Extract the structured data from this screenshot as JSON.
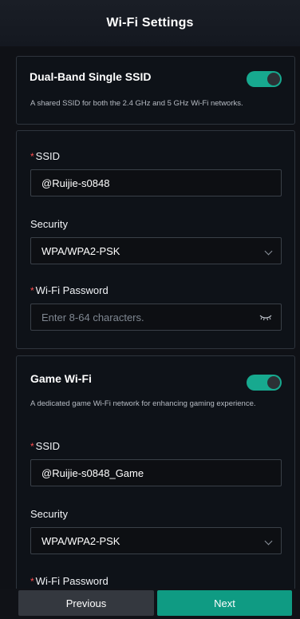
{
  "header": {
    "title": "Wi-Fi Settings"
  },
  "dual_band": {
    "title": "Dual-Band Single SSID",
    "description": "A shared SSID for both the 2.4 GHz and 5 GHz Wi-Fi networks.",
    "enabled": true
  },
  "main_wifi": {
    "ssid_label": "SSID",
    "ssid_value": "@Ruijie-s0848",
    "security_label": "Security",
    "security_value": "WPA/WPA2-PSK",
    "password_label": "Wi-Fi Password",
    "password_placeholder": "Enter 8-64 characters."
  },
  "game_wifi": {
    "title": "Game Wi-Fi",
    "description": "A dedicated game Wi-Fi network for enhancing gaming experience.",
    "enabled": true,
    "ssid_label": "SSID",
    "ssid_value": "@Ruijie-s0848_Game",
    "security_label": "Security",
    "security_value": "WPA/WPA2-PSK",
    "password_label": "Wi-Fi Password"
  },
  "footer": {
    "previous_label": "Previous",
    "next_label": "Next"
  },
  "colors": {
    "background": "#0f1116",
    "toggle_on": "#17a98f",
    "next_button": "#0f9b83",
    "required_mark": "#ff4d4f"
  },
  "icons": {
    "password_visibility": "eye-hidden-icon",
    "select_arrow": "chevron-down-icon"
  }
}
